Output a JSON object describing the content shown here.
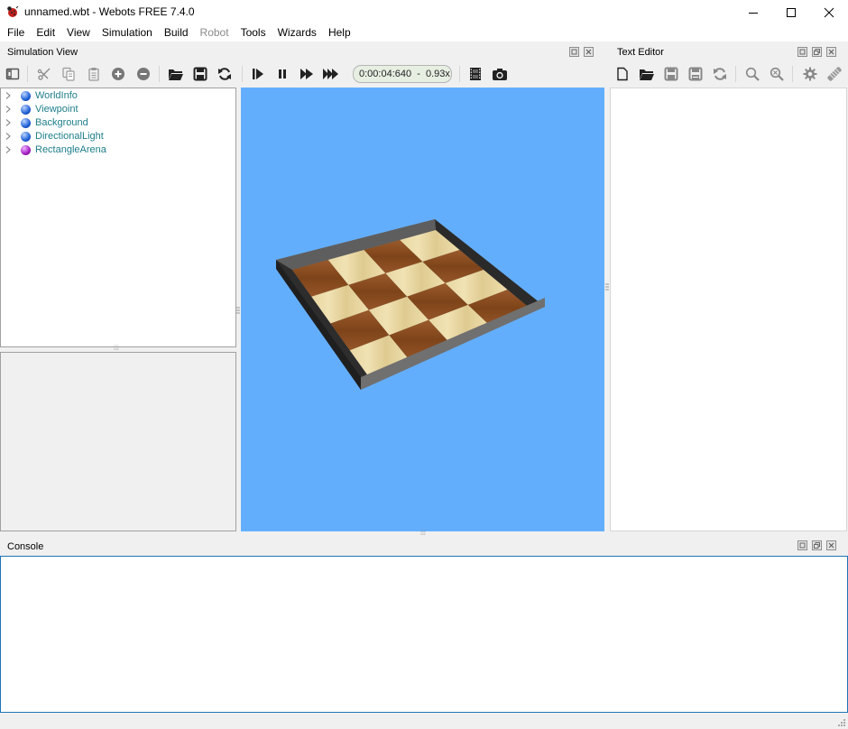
{
  "window": {
    "title": "unnamed.wbt - Webots FREE 7.4.0",
    "app_icon": "ladybug-icon",
    "controls": [
      "minimize-icon",
      "maximize-icon",
      "close-icon"
    ]
  },
  "menubar": {
    "items": [
      {
        "label": "File",
        "enabled": true
      },
      {
        "label": "Edit",
        "enabled": true
      },
      {
        "label": "View",
        "enabled": true
      },
      {
        "label": "Simulation",
        "enabled": true
      },
      {
        "label": "Build",
        "enabled": true
      },
      {
        "label": "Robot",
        "enabled": false
      },
      {
        "label": "Tools",
        "enabled": true
      },
      {
        "label": "Wizards",
        "enabled": true
      },
      {
        "label": "Help",
        "enabled": true
      }
    ]
  },
  "simulation_view": {
    "title": "Simulation View",
    "dock_buttons": [
      "float-icon",
      "close-icon"
    ],
    "toolbar": {
      "buttons": [
        "toggle-scene-tree-icon",
        "cut-icon",
        "copy-icon",
        "paste-icon",
        "add-node-icon",
        "delete-node-icon",
        "open-world-icon",
        "save-world-icon",
        "reload-world-icon",
        "step-icon",
        "pause-icon",
        "run-icon",
        "fast-icon",
        "record-movie-icon",
        "screenshot-icon"
      ],
      "timer": "0:00:04:640  -  0.93x"
    },
    "scene_tree": {
      "nodes": [
        {
          "label": "WorldInfo",
          "color": "#1e5fd6"
        },
        {
          "label": "Viewpoint",
          "color": "#1e5fd6"
        },
        {
          "label": "Background",
          "color": "#1e5fd6"
        },
        {
          "label": "DirectionalLight",
          "color": "#1e5fd6"
        },
        {
          "label": "RectangleArena",
          "color": "#a31bc2"
        }
      ]
    },
    "viewport": {
      "background_color": "#63aefc",
      "object": "RectangleArena"
    }
  },
  "text_editor": {
    "title": "Text Editor",
    "dock_buttons": [
      "restore-icon",
      "float-icon",
      "close-icon"
    ],
    "toolbar": {
      "buttons": [
        "new-file-icon",
        "open-file-icon",
        "save-file-icon",
        "save-as-icon",
        "revert-icon",
        "find-icon",
        "replace-icon",
        "compile-settings-icon",
        "compile-icon"
      ]
    }
  },
  "console": {
    "title": "Console",
    "dock_buttons": [
      "restore-icon",
      "float-icon",
      "close-icon"
    ],
    "content": ""
  }
}
